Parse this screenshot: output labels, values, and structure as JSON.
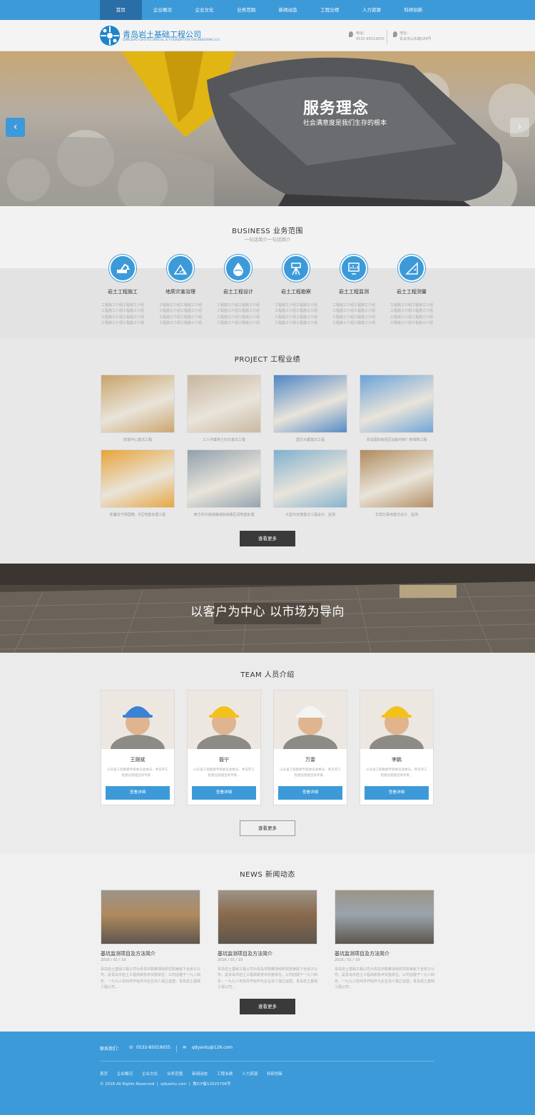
{
  "nav": {
    "items": [
      "首页",
      "企业概况",
      "企业文化",
      "业务范围",
      "新闻动态",
      "工程业绩",
      "人力资源",
      "科研创新"
    ],
    "active_index": 0
  },
  "header": {
    "company_cn": "青岛岩土基础工程公司",
    "company_en": "QINGDAO GEOTECHNICAL & FOUNDATION ENGINEERING CO.",
    "phone_label": "电话：",
    "phone": "0532-85019055",
    "address_label": "地址：",
    "address": "青岛市山东路189号"
  },
  "banner": {
    "title": "服务理念",
    "subtitle": "社会满意度是我们生存的根本",
    "prev_icon": "‹",
    "next_icon": "›"
  },
  "business": {
    "title": "BUSINESS 业务范围",
    "subtitle": "一句话简介一句话简介",
    "items": [
      {
        "label": "岩土工程施工",
        "icon": "excavator-icon",
        "text": "工程施工介绍工程施工介绍工程施工介绍工程施工介绍工程施工介绍工程施工介绍工程施工介绍工程施工介绍"
      },
      {
        "label": "地质灾害治理",
        "icon": "landslide-icon",
        "text": "工程施工介绍工程施工介绍工程施工介绍工程施工介绍工程施工介绍工程施工介绍工程施工介绍工程施工介绍"
      },
      {
        "label": "岩土工程设计",
        "icon": "drop-icon",
        "text": "工程施工介绍工程施工介绍工程施工介绍工程施工介绍工程施工介绍工程施工介绍工程施工介绍工程施工介绍"
      },
      {
        "label": "岩土工程勘察",
        "icon": "survey-icon",
        "text": "工程施工介绍工程施工介绍工程施工介绍工程施工介绍工程施工介绍工程施工介绍工程施工介绍工程施工介绍"
      },
      {
        "label": "岩土工程监测",
        "icon": "monitor-icon",
        "text": "工程施工介绍工程施工介绍工程施工介绍工程施工介绍工程施工介绍工程施工介绍工程施工介绍工程施工介绍"
      },
      {
        "label": "岩土工程测量",
        "icon": "triangle-ruler-icon",
        "text": "工程施工介绍工程施工介绍工程施工介绍工程施工介绍工程施工介绍工程施工介绍工程施工介绍工程施工介绍"
      }
    ]
  },
  "project": {
    "title": "PROJECT 工程业绩",
    "items": [
      {
        "caption": "财富中心基坑工程",
        "theme": "#c9a36a"
      },
      {
        "caption": "工人作業辨土石方基坑工程",
        "theme": "#c8b6a0"
      },
      {
        "caption": "国华大厦基坑工程",
        "theme": "#4f86c6"
      },
      {
        "caption": "青岛国际商贸区运输中转厂房保障工程",
        "theme": "#6aa3d8"
      },
      {
        "caption": "和馨花千街国際、E区地基处理工程",
        "theme": "#e8a33a"
      },
      {
        "caption": "西方实乐城道路城际铁路区间地基处理",
        "theme": "#8fa0ad"
      },
      {
        "caption": "大型内支撑基坑工程设计、监测",
        "theme": "#7fb0cf"
      },
      {
        "caption": "华润万豪地基坑设计、监测",
        "theme": "#b08a5e"
      }
    ],
    "more_label": "查看更多"
  },
  "slogan": {
    "text": "以客户为中心 以市场为导向"
  },
  "team": {
    "title": "TEAM 人员介绍",
    "members": [
      {
        "name": "王刚斌",
        "desc": "山东省工程勘察专家委员会委员、青岛市工程建设管理咨询专家...",
        "button": "查看详细"
      },
      {
        "name": "聂宁",
        "desc": "山东省工程勘察专家委员会委员、青岛市工程建设管理咨询专家...",
        "button": "查看详细"
      },
      {
        "name": "万雷",
        "desc": "山东省工程勘察专家委员会委员、青岛市工程建设管理咨询专家...",
        "button": "查看详细"
      },
      {
        "name": "李鹏",
        "desc": "山东省工程勘察专家委员会委员、青岛市工程建设管理咨询专家...",
        "button": "查看详细"
      }
    ],
    "more_label": "查看更多"
  },
  "news": {
    "title": "NEWS 新闻动态",
    "items": [
      {
        "title": "基坑监测项目及方法简介",
        "date": "2016 / 01 / 19",
        "text": "青岛岩土基础工程公司为青岛市勘察测绘研究院隶属下全资子公司，是青岛市岩土工程高新技术实施单位。公司创建于一九八四年，一九九三年四月开始作为企业法人独立运营。青岛岩土基础工程公司..."
      },
      {
        "title": "基坑监测项目及方法简介",
        "date": "2016 / 01 / 19",
        "text": "青岛岩土基础工程公司为青岛市勘察测绘研究院隶属下全资子公司，是青岛市岩土工程高新技术实施单位。公司创建于一九八四年，一九九三年四月开始作为企业法人独立运营。青岛岩土基础工程公司..."
      },
      {
        "title": "基坑监测项目及方法简介",
        "date": "2016 / 01 / 19",
        "text": "青岛岩土基础工程公司为青岛市勘察测绘研究院隶属下全资子公司，是青岛市岩土工程高新技术实施单位。公司创建于一九八四年，一九九三年四月开始作为企业法人独立运营。青岛岩土基础工程公司..."
      }
    ],
    "more_label": "查看更多"
  },
  "footer": {
    "contact_label": "联系我们：",
    "phone": "0532-85019055",
    "email": "qdyantu@126.com",
    "links": [
      "首页",
      "企业概况",
      "企业文化",
      "业务范围",
      "新闻动态",
      "工程业绩",
      "人力资源",
      "科研创新"
    ],
    "copyright": "© 2016 All Rights Reserved",
    "domain": "qdyantu.com",
    "icp": "鲁ICP备12025706号"
  },
  "colors": {
    "primary": "#3d9ad9",
    "nav_active": "#2a6ea8",
    "dark_button": "#3a3a3a"
  }
}
